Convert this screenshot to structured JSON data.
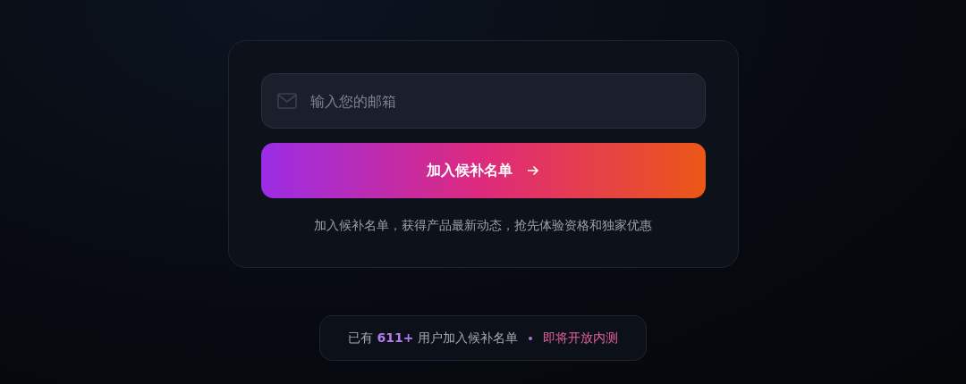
{
  "signup_card": {
    "email_field": {
      "placeholder": "输入您的邮箱"
    },
    "join_button": {
      "label": "加入候补名单"
    },
    "caption": "加入候补名单，获得产品最新动态，抢先体验资格和独家优惠"
  },
  "stats_badge": {
    "count_text": "已有 **611+** 用户加入候补名单",
    "status": "即将开放内测"
  }
}
